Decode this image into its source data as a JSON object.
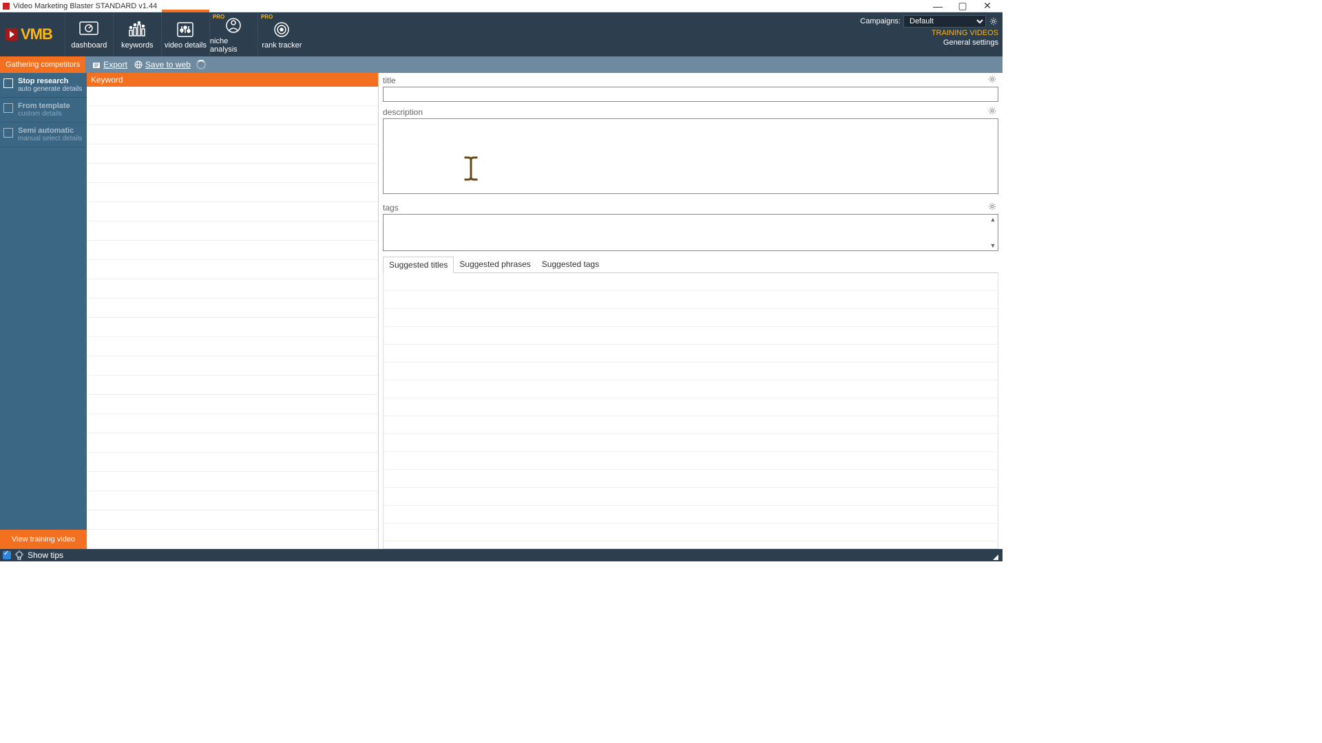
{
  "window": {
    "title": "Video Marketing Blaster STANDARD v1.44"
  },
  "nav": {
    "logo": "VMB",
    "items": [
      {
        "label": "dashboard",
        "pro": false
      },
      {
        "label": "keywords",
        "pro": false
      },
      {
        "label": "video details",
        "pro": false
      },
      {
        "label": "niche analysis",
        "pro": true
      },
      {
        "label": "rank tracker",
        "pro": true
      }
    ],
    "pro_badge": "PRO",
    "campaigns_label": "Campaigns:",
    "campaign_selected": "Default",
    "training_videos": "TRAINING VIDEOS",
    "general_settings": "General settings"
  },
  "actionbar": {
    "gathering": "Gathering competitors",
    "export": "Export",
    "save_to_web": "Save to web"
  },
  "sidebar": {
    "items": [
      {
        "title": "Stop research",
        "sub": "auto generate details"
      },
      {
        "title": "From template",
        "sub": "custom details"
      },
      {
        "title": "Semi automatic",
        "sub": "manual select details"
      }
    ],
    "view_training": "View training video"
  },
  "keyword_col": {
    "header": "Keyword"
  },
  "details": {
    "title_label": "title",
    "title_value": "",
    "description_label": "description",
    "description_value": "",
    "tags_label": "tags",
    "tags_value": ""
  },
  "suggestions": {
    "tabs": [
      "Suggested titles",
      "Suggested phrases",
      "Suggested tags"
    ],
    "active_tab": 0
  },
  "bottombar": {
    "show_tips": "Show tips"
  }
}
